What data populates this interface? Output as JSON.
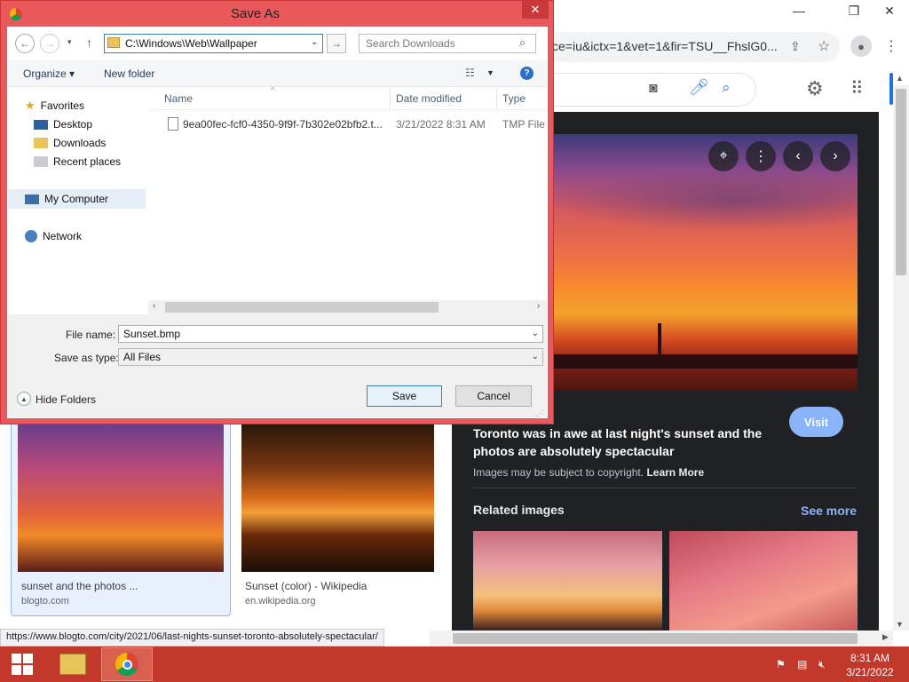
{
  "browser": {
    "url_fragment": "ce=iu&ictx=1&vet=1&fir=TSU__FhslG0...",
    "minimize": "—",
    "restore": "❐",
    "close": "✕"
  },
  "preview": {
    "title": "Toronto was in awe at last night's sunset and the photos are absolutely spectacular",
    "visit_label": "Visit",
    "copyright_prefix": "Images may be subject to copyright.",
    "learn_more": "Learn More",
    "related_label": "Related images",
    "see_more": "See more"
  },
  "results": [
    {
      "caption": "sunset and the photos ...",
      "source": "blogto.com"
    },
    {
      "caption": "Sunset (color) - Wikipedia",
      "source": "en.wikipedia.org"
    }
  ],
  "status_url": "https://www.blogto.com/city/2021/06/last-nights-sunset-toronto-absolutely-spectacular/",
  "dialog": {
    "title": "Save As",
    "close": "✕",
    "address": "C:\\Windows\\Web\\Wallpaper",
    "search_placeholder": "Search Downloads",
    "organize": "Organize ▾",
    "new_folder": "New folder",
    "nav": {
      "favorites": "Favorites",
      "desktop": "Desktop",
      "downloads": "Downloads",
      "recent": "Recent places",
      "computer": "My Computer",
      "network": "Network"
    },
    "columns": {
      "name": "Name",
      "date": "Date modified",
      "type": "Type"
    },
    "files": [
      {
        "name": "9ea00fec-fcf0-4350-9f9f-7b302e02bfb2.t...",
        "date": "3/21/2022 8:31 AM",
        "type": "TMP File"
      }
    ],
    "file_name_label": "File name:",
    "file_name": "Sunset.bmp",
    "save_type_label": "Save as type:",
    "save_type": "All Files",
    "hide_folders": "Hide Folders",
    "save": "Save",
    "cancel": "Cancel"
  },
  "taskbar": {
    "time": "8:31 AM",
    "date": "3/21/2022"
  },
  "colors": {
    "dialog_frame": "#e9585a",
    "taskbar": "#c2382b",
    "panel_bg": "#202124",
    "accent": "#8ab4f8"
  }
}
